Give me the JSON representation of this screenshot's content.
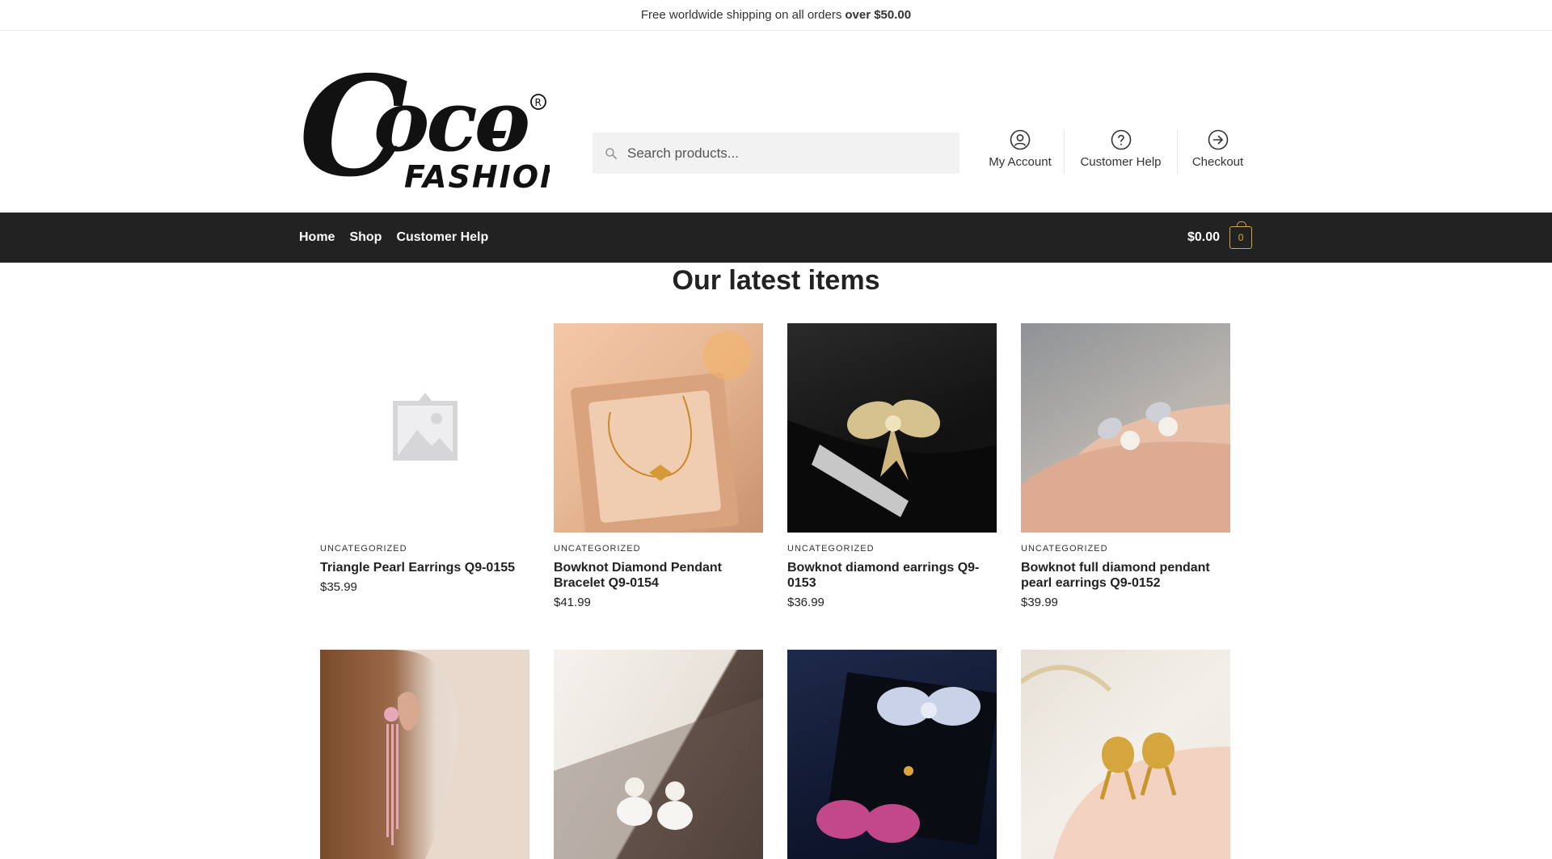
{
  "notice": {
    "text": "Free worldwide shipping on all orders",
    "bold": "over $50.00"
  },
  "logo": {
    "main": "Coco-",
    "sub": "FASHION",
    "mark": "®"
  },
  "search": {
    "placeholder": "Search products..."
  },
  "header_links": [
    {
      "label": "My Account",
      "icon": "user-circle-icon"
    },
    {
      "label": "Customer Help",
      "icon": "question-circle-icon"
    },
    {
      "label": "Checkout",
      "icon": "arrow-right-circle-icon"
    }
  ],
  "nav": {
    "items": [
      "Home",
      "Shop",
      "Customer Help"
    ]
  },
  "cart": {
    "total": "$0.00",
    "count": "0"
  },
  "section": {
    "title": "Our latest items"
  },
  "products": [
    {
      "category": "UNCATEGORIZED",
      "name": "Triangle Pearl Earrings Q9-0155",
      "price": "$35.99",
      "image": "placeholder-image"
    },
    {
      "category": "UNCATEGORIZED",
      "name": "Bowknot Diamond Pendant Bracelet Q9-0154",
      "price": "$41.99",
      "image": "gold-bracelet-photo"
    },
    {
      "category": "UNCATEGORIZED",
      "name": "Bowknot diamond earrings Q9-0153",
      "price": "$36.99",
      "image": "diamond-bow-brooch-photo"
    },
    {
      "category": "UNCATEGORIZED",
      "name": "Bowknot full diamond pendant pearl earrings Q9-0152",
      "price": "$39.99",
      "image": "pearl-bow-earrings-photo"
    }
  ],
  "products_row2": [
    {
      "image": "pink-tassel-earring-photo"
    },
    {
      "image": "pearl-bow-studs-photo"
    },
    {
      "image": "crystal-bow-set-photo"
    },
    {
      "image": "gold-bow-studs-photo"
    }
  ],
  "colors": {
    "nav_bg": "#222222",
    "accent": "#d9a441"
  }
}
